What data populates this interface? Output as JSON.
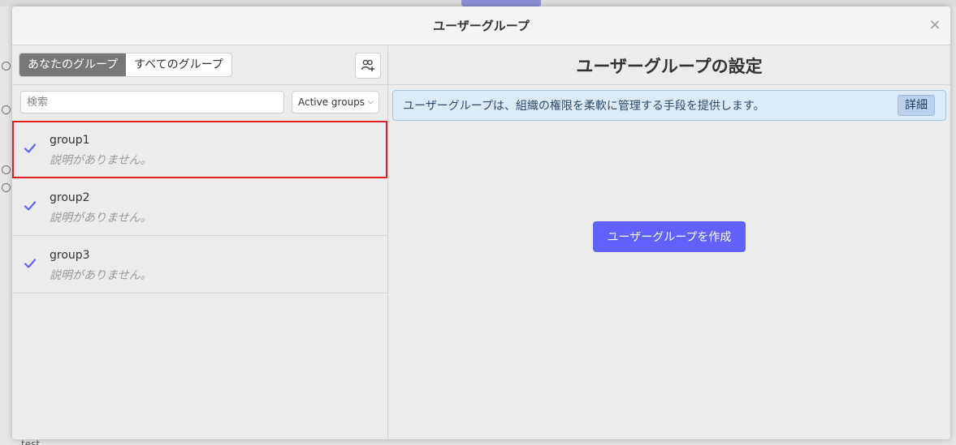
{
  "modal": {
    "title": "ユーザーグループ",
    "close_label": "×"
  },
  "left_pane": {
    "tabs": [
      {
        "label": "あなたのグループ",
        "active": true
      },
      {
        "label": "すべてのグループ",
        "active": false
      }
    ],
    "add_group_icon": "add-user-group-icon",
    "search": {
      "placeholder": "検索",
      "value": ""
    },
    "filter": {
      "selected": "Active groups"
    },
    "groups": [
      {
        "name": "group1",
        "description": "説明がありません。",
        "selected": true
      },
      {
        "name": "group2",
        "description": "説明がありません。",
        "selected": false
      },
      {
        "name": "group3",
        "description": "説明がありません。",
        "selected": false
      }
    ]
  },
  "right_pane": {
    "title": "ユーザーグループの設定",
    "info_text": "ユーザーグループは、組織の権限を柔軟に管理する手段を提供します。",
    "details_label": "詳細",
    "create_label": "ユーザーグループを作成"
  },
  "colors": {
    "accent": "#6161ff",
    "check": "#6161ff",
    "selected_outline": "#e02020",
    "info_bg": "#dcebf8"
  },
  "background": {
    "bottom_text": "test"
  }
}
